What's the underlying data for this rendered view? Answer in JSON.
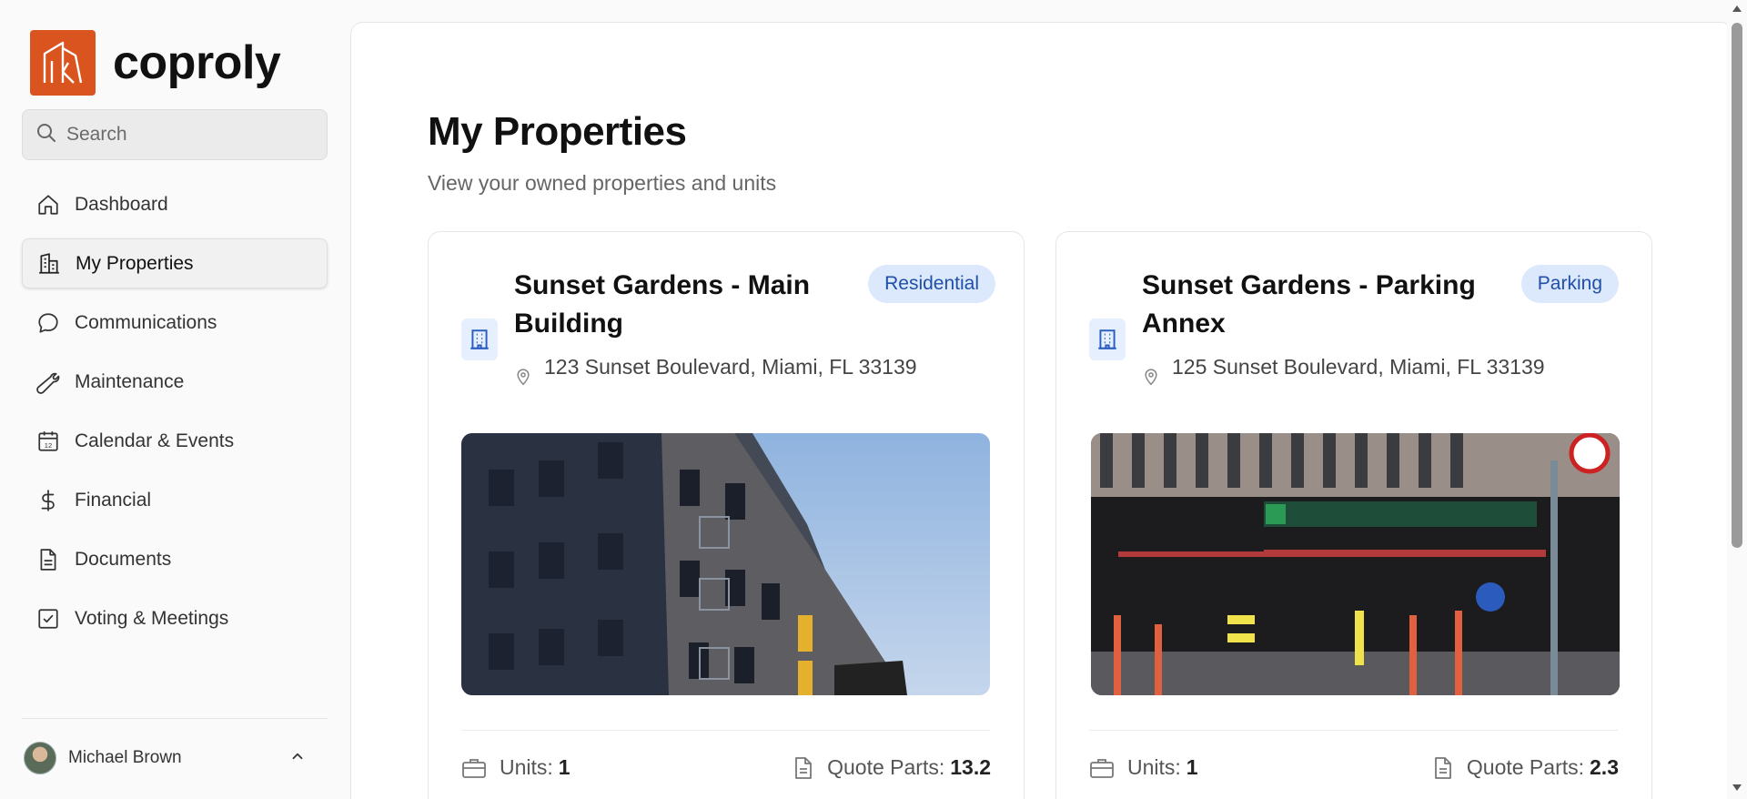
{
  "app": {
    "name": "coproly",
    "brand_color": "#d9541e",
    "accent_color": "#1f4fa8"
  },
  "search": {
    "placeholder": "Search"
  },
  "sidebar": {
    "items": [
      {
        "label": "Dashboard",
        "icon": "home-icon",
        "active": false
      },
      {
        "label": "My Properties",
        "icon": "buildings-icon",
        "active": true
      },
      {
        "label": "Communications",
        "icon": "chat-bubble-icon",
        "active": false
      },
      {
        "label": "Maintenance",
        "icon": "wrench-icon",
        "active": false
      },
      {
        "label": "Calendar & Events",
        "icon": "calendar-icon",
        "active": false
      },
      {
        "label": "Financial",
        "icon": "dollar-icon",
        "active": false
      },
      {
        "label": "Documents",
        "icon": "document-icon",
        "active": false
      },
      {
        "label": "Voting & Meetings",
        "icon": "checkbox-icon",
        "active": false
      }
    ]
  },
  "user": {
    "name": "Michael Brown",
    "menu_icon": "chevron-up-icon"
  },
  "page": {
    "title": "My Properties",
    "subtitle": "View your owned properties and units"
  },
  "properties": [
    {
      "name": "Sunset Gardens - Main Building",
      "type": "Residential",
      "address": "123 Sunset Boulevard, Miami, FL 33139",
      "image": "apartment-building-photo",
      "units_label": "Units:",
      "units_value": "1",
      "quote_label": "Quote Parts:",
      "quote_value": "13.2"
    },
    {
      "name": "Sunset Gardens - Parking Annex",
      "type": "Parking",
      "address": "125 Sunset Boulevard, Miami, FL 33139",
      "image": "parking-garage-photo",
      "units_label": "Units:",
      "units_value": "1",
      "quote_label": "Quote Parts:",
      "quote_value": "2.3"
    }
  ]
}
